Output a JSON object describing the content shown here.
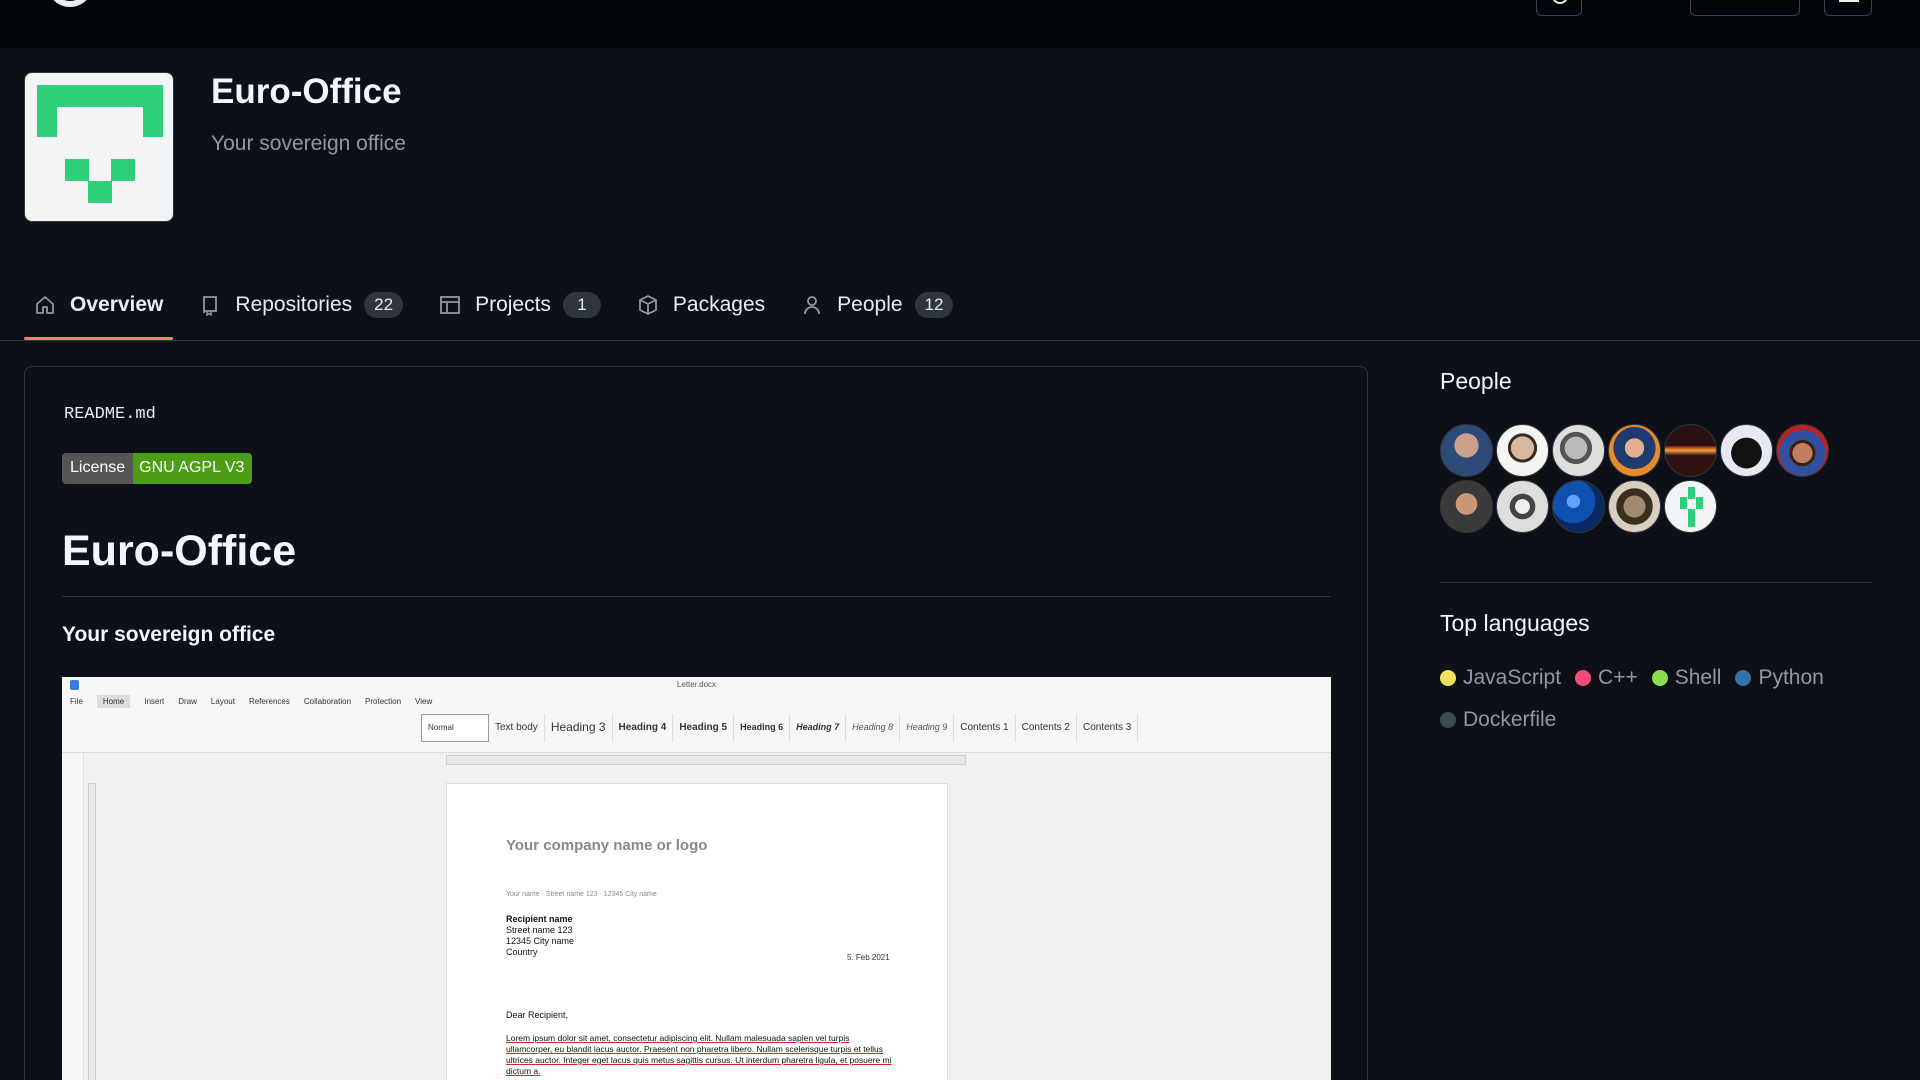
{
  "org": {
    "name": "Euro-Office",
    "description": "Your sovereign office"
  },
  "tabs": [
    {
      "label": "Overview",
      "icon": "home-icon"
    },
    {
      "label": "Repositories",
      "count": "22",
      "icon": "repo-icon"
    },
    {
      "label": "Projects",
      "count": "1",
      "icon": "table-icon"
    },
    {
      "label": "Packages",
      "icon": "package-icon"
    },
    {
      "label": "People",
      "count": "12",
      "icon": "person-icon"
    }
  ],
  "readme": {
    "filename": "README.md",
    "badge_label": "License",
    "badge_value": "GNU AGPL V3",
    "heading": "Euro-Office",
    "subheading": "Your sovereign office"
  },
  "screenshot": {
    "doc_title": "Letter.docx",
    "menu": [
      "File",
      "Home",
      "Insert",
      "Draw",
      "Layout",
      "References",
      "Collaboration",
      "Protection",
      "View"
    ],
    "styles": [
      "Normal",
      "Text body",
      "Heading 3",
      "Heading 4",
      "Heading 5",
      "Heading 6",
      "Heading 7",
      "Heading 8",
      "Heading 9",
      "Contents 1",
      "Contents 2",
      "Contents 3"
    ],
    "company": "Your company name or logo",
    "sender": "Your name · Street name 123 · 12345 City name",
    "recipient": [
      "Recipient name",
      "Street name 123",
      "12345 City name",
      "Country"
    ],
    "date": "5. Feb 2021",
    "salutation": "Dear Recipient,",
    "body": "Lorem ipsum dolor sit amet, consectetur adipiscing elit. Nullam malesuada sapien vel turpis ullamcorper, eu blandit lacus auctor. Praesent non pharetra libero. Nullam scelerisque turpis et tellus ultrices auctor. Integer eget lacus quis metus sagittis cursus. Ut interdum pharetra ligula, et posuere mi dictum a."
  },
  "sidebar": {
    "people_title": "People",
    "languages_title": "Top languages",
    "languages": [
      {
        "name": "JavaScript",
        "color": "#f1e05a"
      },
      {
        "name": "C++",
        "color": "#f34b7d"
      },
      {
        "name": "Shell",
        "color": "#89e051"
      },
      {
        "name": "Python",
        "color": "#3572a5"
      },
      {
        "name": "Dockerfile",
        "color": "#384d54"
      }
    ]
  }
}
